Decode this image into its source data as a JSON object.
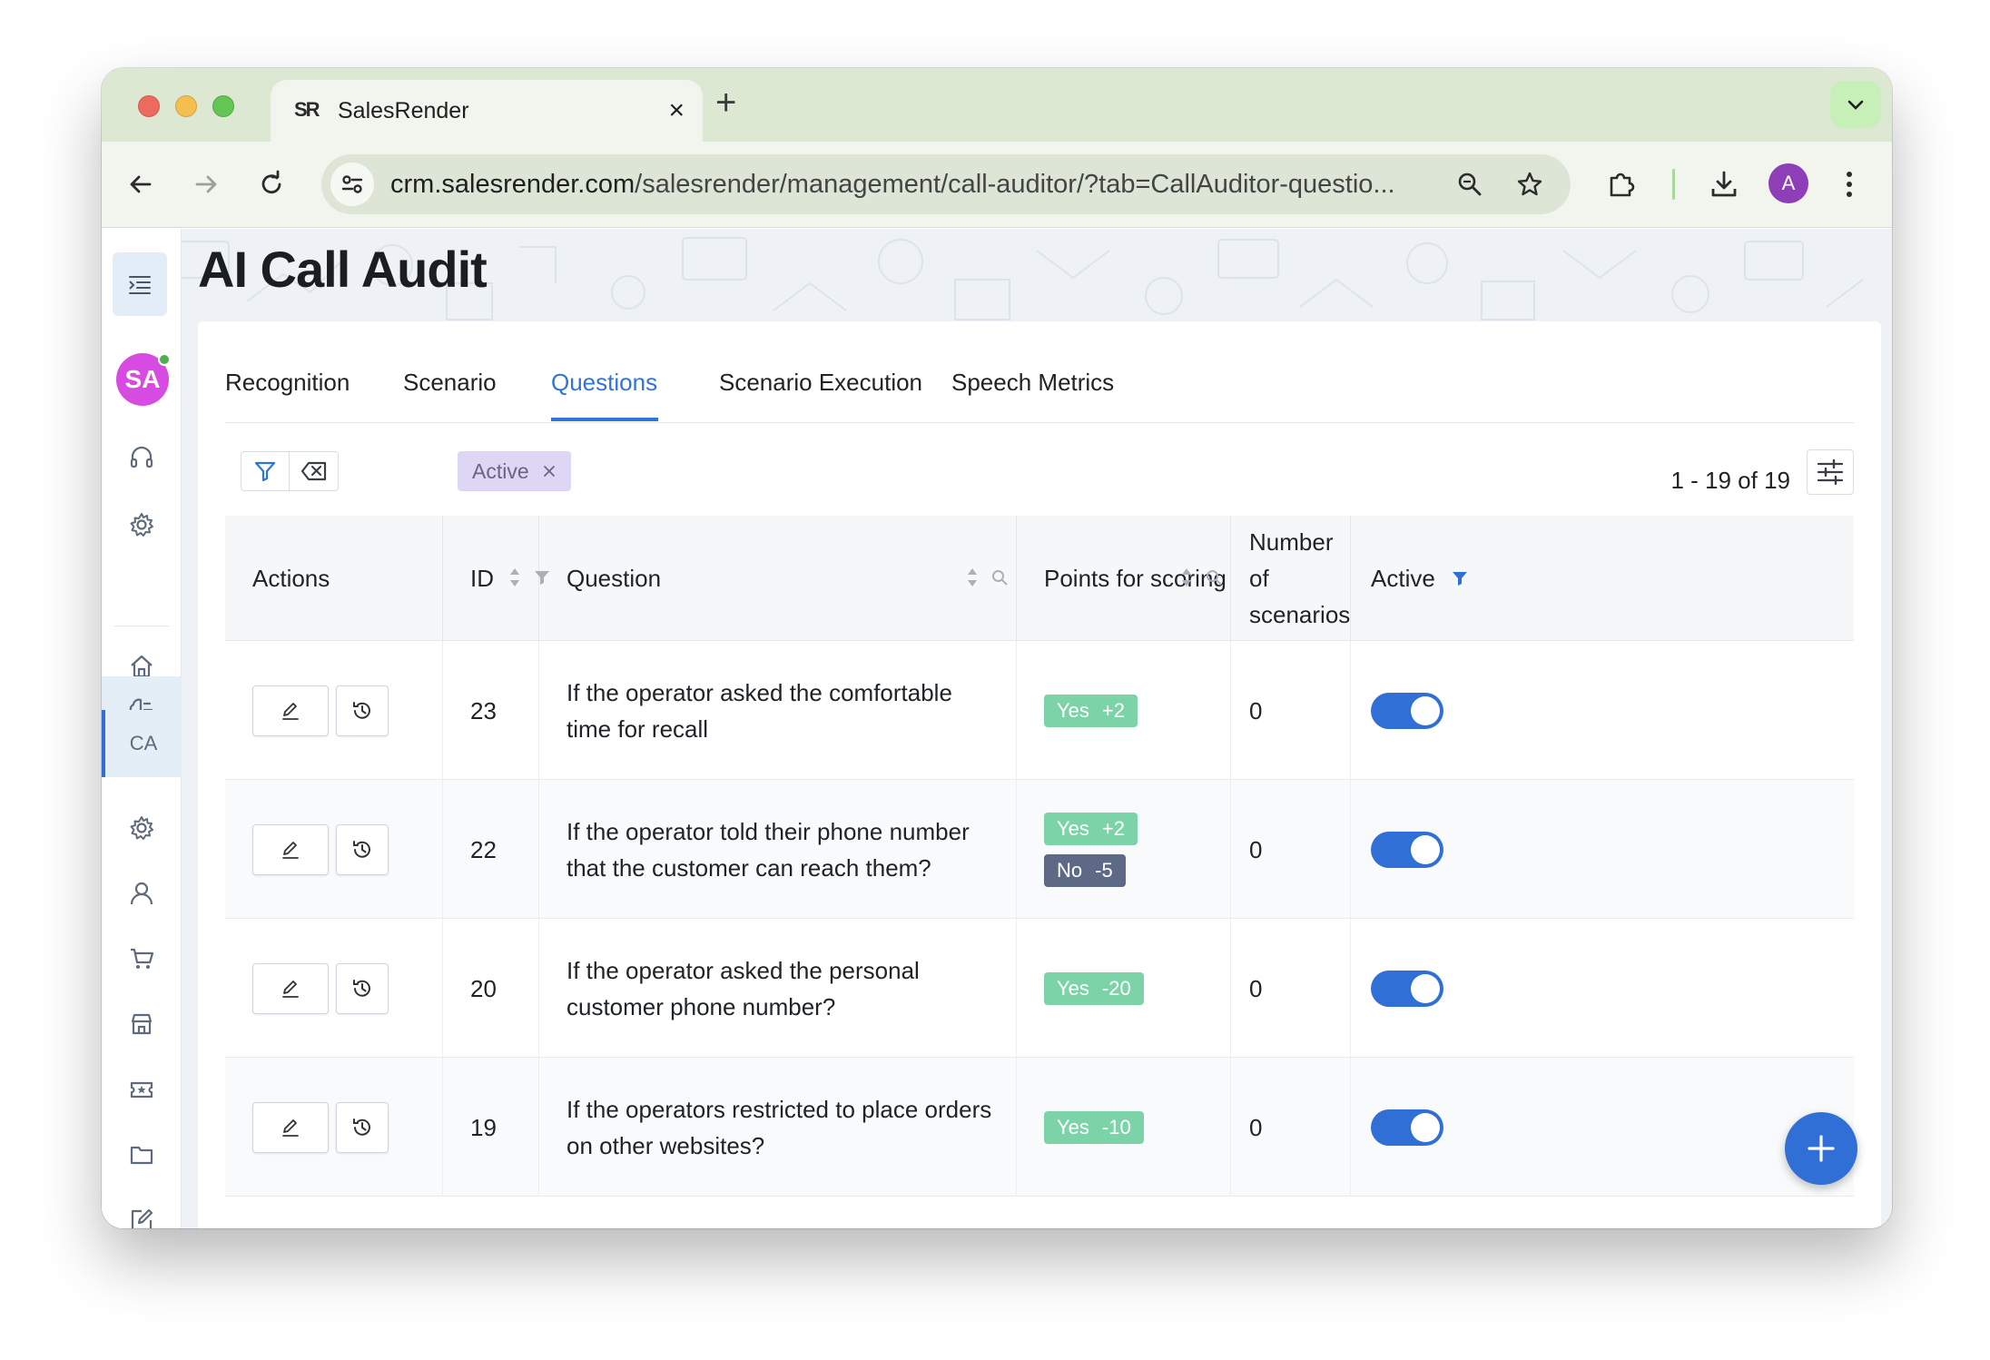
{
  "browser": {
    "tab_title": "SalesRender",
    "favicon_text": "SR",
    "url_host": "crm.salesrender.com",
    "url_path": "/salesrender/management/call-auditor/?tab=CallAuditor-questio...",
    "profile_initial": "A"
  },
  "sidebar": {
    "avatar_initials": "SA",
    "ca_label": "CA",
    "icons": [
      "menu-icon",
      "headset-icon",
      "gear-icon",
      "home-icon",
      "ai-brain-icon",
      "gear-icon",
      "user-icon",
      "cart-icon",
      "store-icon",
      "ticket-icon",
      "folder-icon",
      "edit-icon"
    ]
  },
  "page": {
    "title": "AI Call Audit"
  },
  "tabs": [
    "Recognition",
    "Scenario",
    "Questions",
    "Scenario Execution",
    "Speech Metrics"
  ],
  "active_tab": "Questions",
  "filters": {
    "active_chip": "Active"
  },
  "pager": {
    "text": "1 - 19 of 19"
  },
  "table": {
    "headers": {
      "actions": "Actions",
      "id": "ID",
      "question": "Question",
      "points": "Points for scoring",
      "scenarios_line1": "Number of",
      "scenarios_line2": "scenarios",
      "active": "Active"
    },
    "rows": [
      {
        "id": "23",
        "question": "If the operator asked the comfortable time for recall",
        "points": [
          {
            "label": "Yes",
            "value": "+2",
            "kind": "yes"
          }
        ],
        "scenarios": "0",
        "active": true
      },
      {
        "id": "22",
        "question": "If the operator told their phone number that the customer can reach them?",
        "points": [
          {
            "label": "Yes",
            "value": "+2",
            "kind": "yes"
          },
          {
            "label": "No",
            "value": "-5",
            "kind": "no"
          }
        ],
        "scenarios": "0",
        "active": true
      },
      {
        "id": "20",
        "question": "If the operator asked the personal customer phone number?",
        "points": [
          {
            "label": "Yes",
            "value": "-20",
            "kind": "yes"
          }
        ],
        "scenarios": "0",
        "active": true
      },
      {
        "id": "19",
        "question": "If the operators restricted to place orders on other websites?",
        "points": [
          {
            "label": "Yes",
            "value": "-10",
            "kind": "yes"
          }
        ],
        "scenarios": "0",
        "active": true
      }
    ]
  },
  "colors": {
    "accent": "#2f6fd6",
    "yes_badge": "#7dd3a8",
    "no_badge": "#5e6a85",
    "chip_bg": "#ddd6f5",
    "avatar_bg": "#d84be3"
  }
}
